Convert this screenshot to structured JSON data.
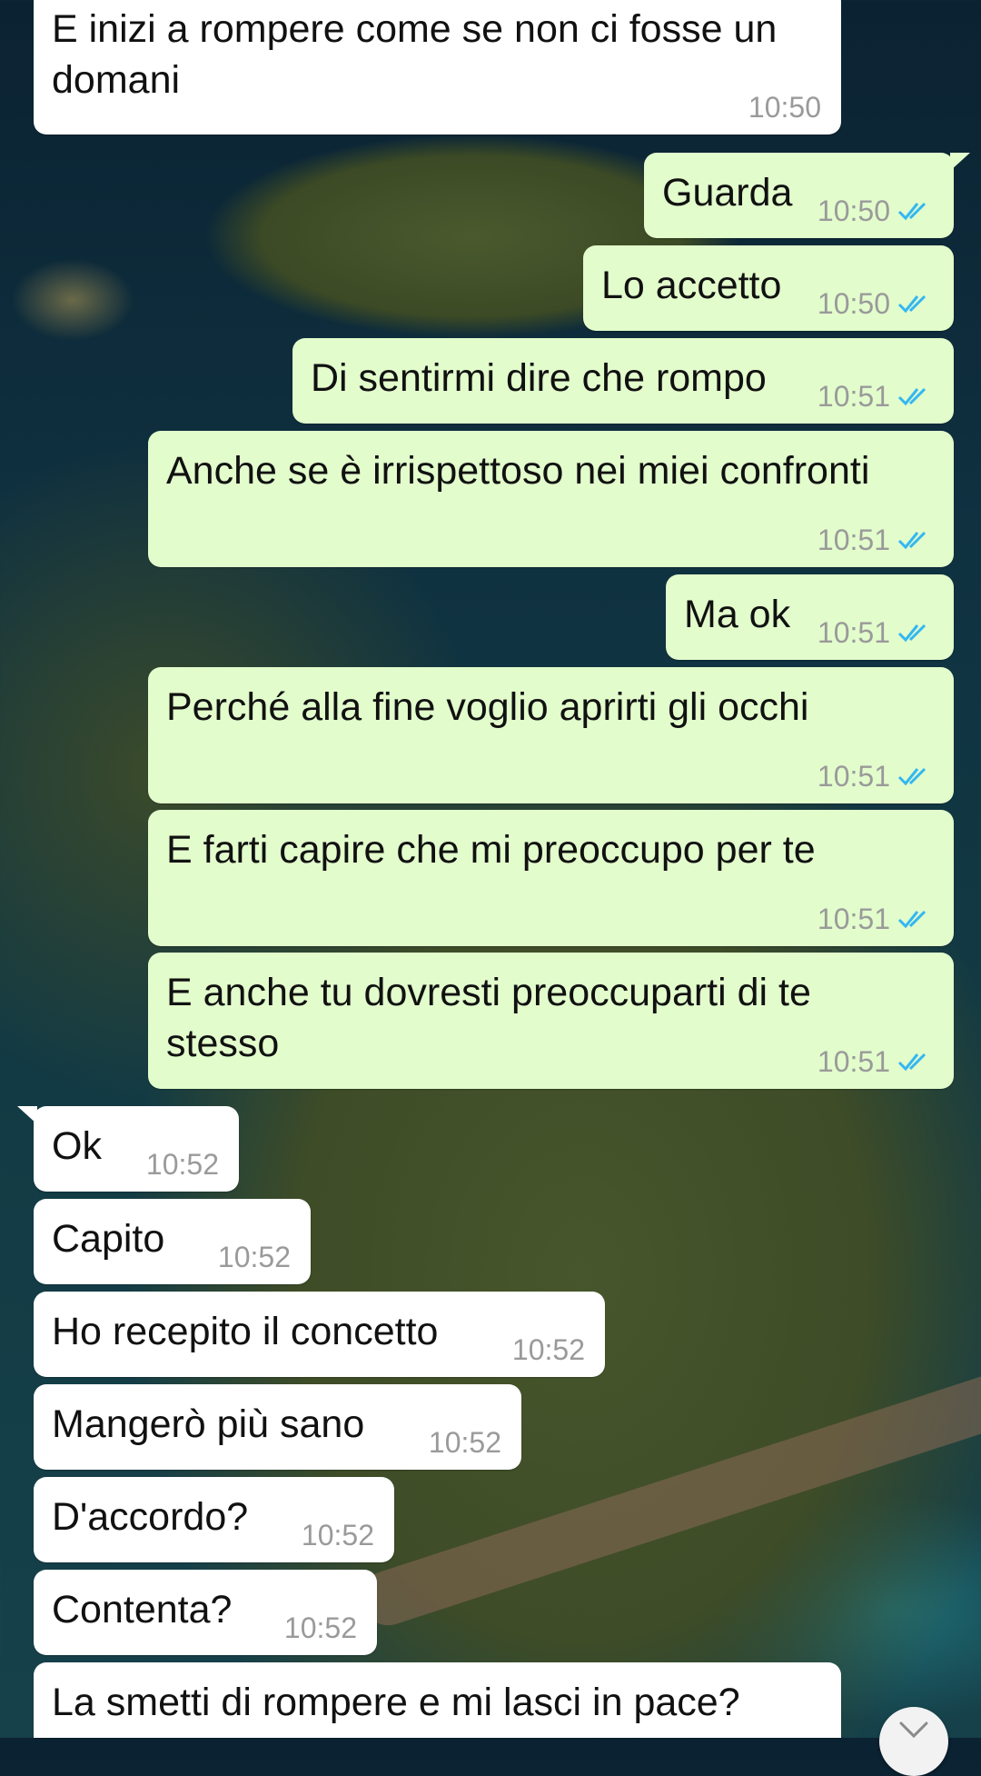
{
  "chat": {
    "messages": [
      {
        "text": "E inizi a rompere come se non ci fosse un\ndomani",
        "time": "10:50",
        "dir": "in",
        "read": false
      },
      {
        "text": "Guarda",
        "time": "10:50",
        "dir": "out",
        "read": true
      },
      {
        "text": "Lo accetto",
        "time": "10:50",
        "dir": "out",
        "read": true
      },
      {
        "text": "Di sentirmi dire che rompo",
        "time": "10:51",
        "dir": "out",
        "read": true
      },
      {
        "text": "Anche se è irrispettoso nei miei confronti",
        "time": "10:51",
        "dir": "out",
        "read": true
      },
      {
        "text": "Ma ok",
        "time": "10:51",
        "dir": "out",
        "read": true
      },
      {
        "text": "Perché alla fine voglio aprirti gli occhi",
        "time": "10:51",
        "dir": "out",
        "read": true
      },
      {
        "text": "E farti capire che mi preoccupo per te",
        "time": "10:51",
        "dir": "out",
        "read": true
      },
      {
        "text": "E anche tu dovresti preoccuparti di te\nstesso",
        "time": "10:51",
        "dir": "out",
        "read": true
      },
      {
        "text": "Ok",
        "time": "10:52",
        "dir": "in"
      },
      {
        "text": "Capito",
        "time": "10:52",
        "dir": "in"
      },
      {
        "text": "Ho recepito il concetto",
        "time": "10:52",
        "dir": "in"
      },
      {
        "text": "Mangerò più sano",
        "time": "10:52",
        "dir": "in"
      },
      {
        "text": "D'accordo?",
        "time": "10:52",
        "dir": "in"
      },
      {
        "text": "Contenta?",
        "time": "10:52",
        "dir": "in"
      },
      {
        "text": "La smetti di rompere e mi lasci in pace?",
        "time": "",
        "dir": "in"
      }
    ]
  },
  "colors": {
    "incoming_bubble": "#ffffff",
    "outgoing_bubble": "#e2fccc",
    "read_ticks": "#34b7f1",
    "timestamp": "#9a9a9a"
  },
  "icons": {
    "read_receipt": "double-check-icon",
    "scroll_button": "chevron-down-icon"
  }
}
